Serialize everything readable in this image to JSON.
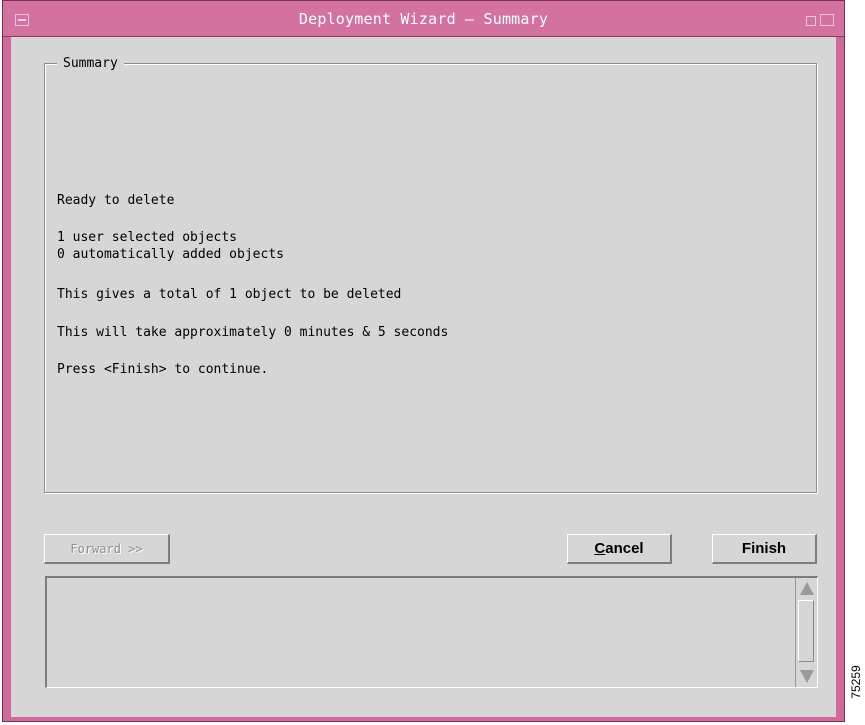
{
  "window": {
    "title": "Deployment Wizard — Summary"
  },
  "summary": {
    "group_label": "Summary",
    "lines": [
      "Ready to delete",
      "1 user selected objects",
      "0 automatically added objects",
      "This gives a total of 1 object to be deleted",
      "This will take approximately 0 minutes & 5 seconds",
      "Press <Finish> to continue."
    ]
  },
  "buttons": {
    "forward": "Forward >>",
    "cancel_first": "C",
    "cancel_rest": "ancel",
    "finish": "Finish"
  },
  "figure_id": "75259",
  "colors": {
    "titlebar": "#d4729f",
    "frame": "#cf6a9a",
    "panel": "#d6d6d6"
  }
}
